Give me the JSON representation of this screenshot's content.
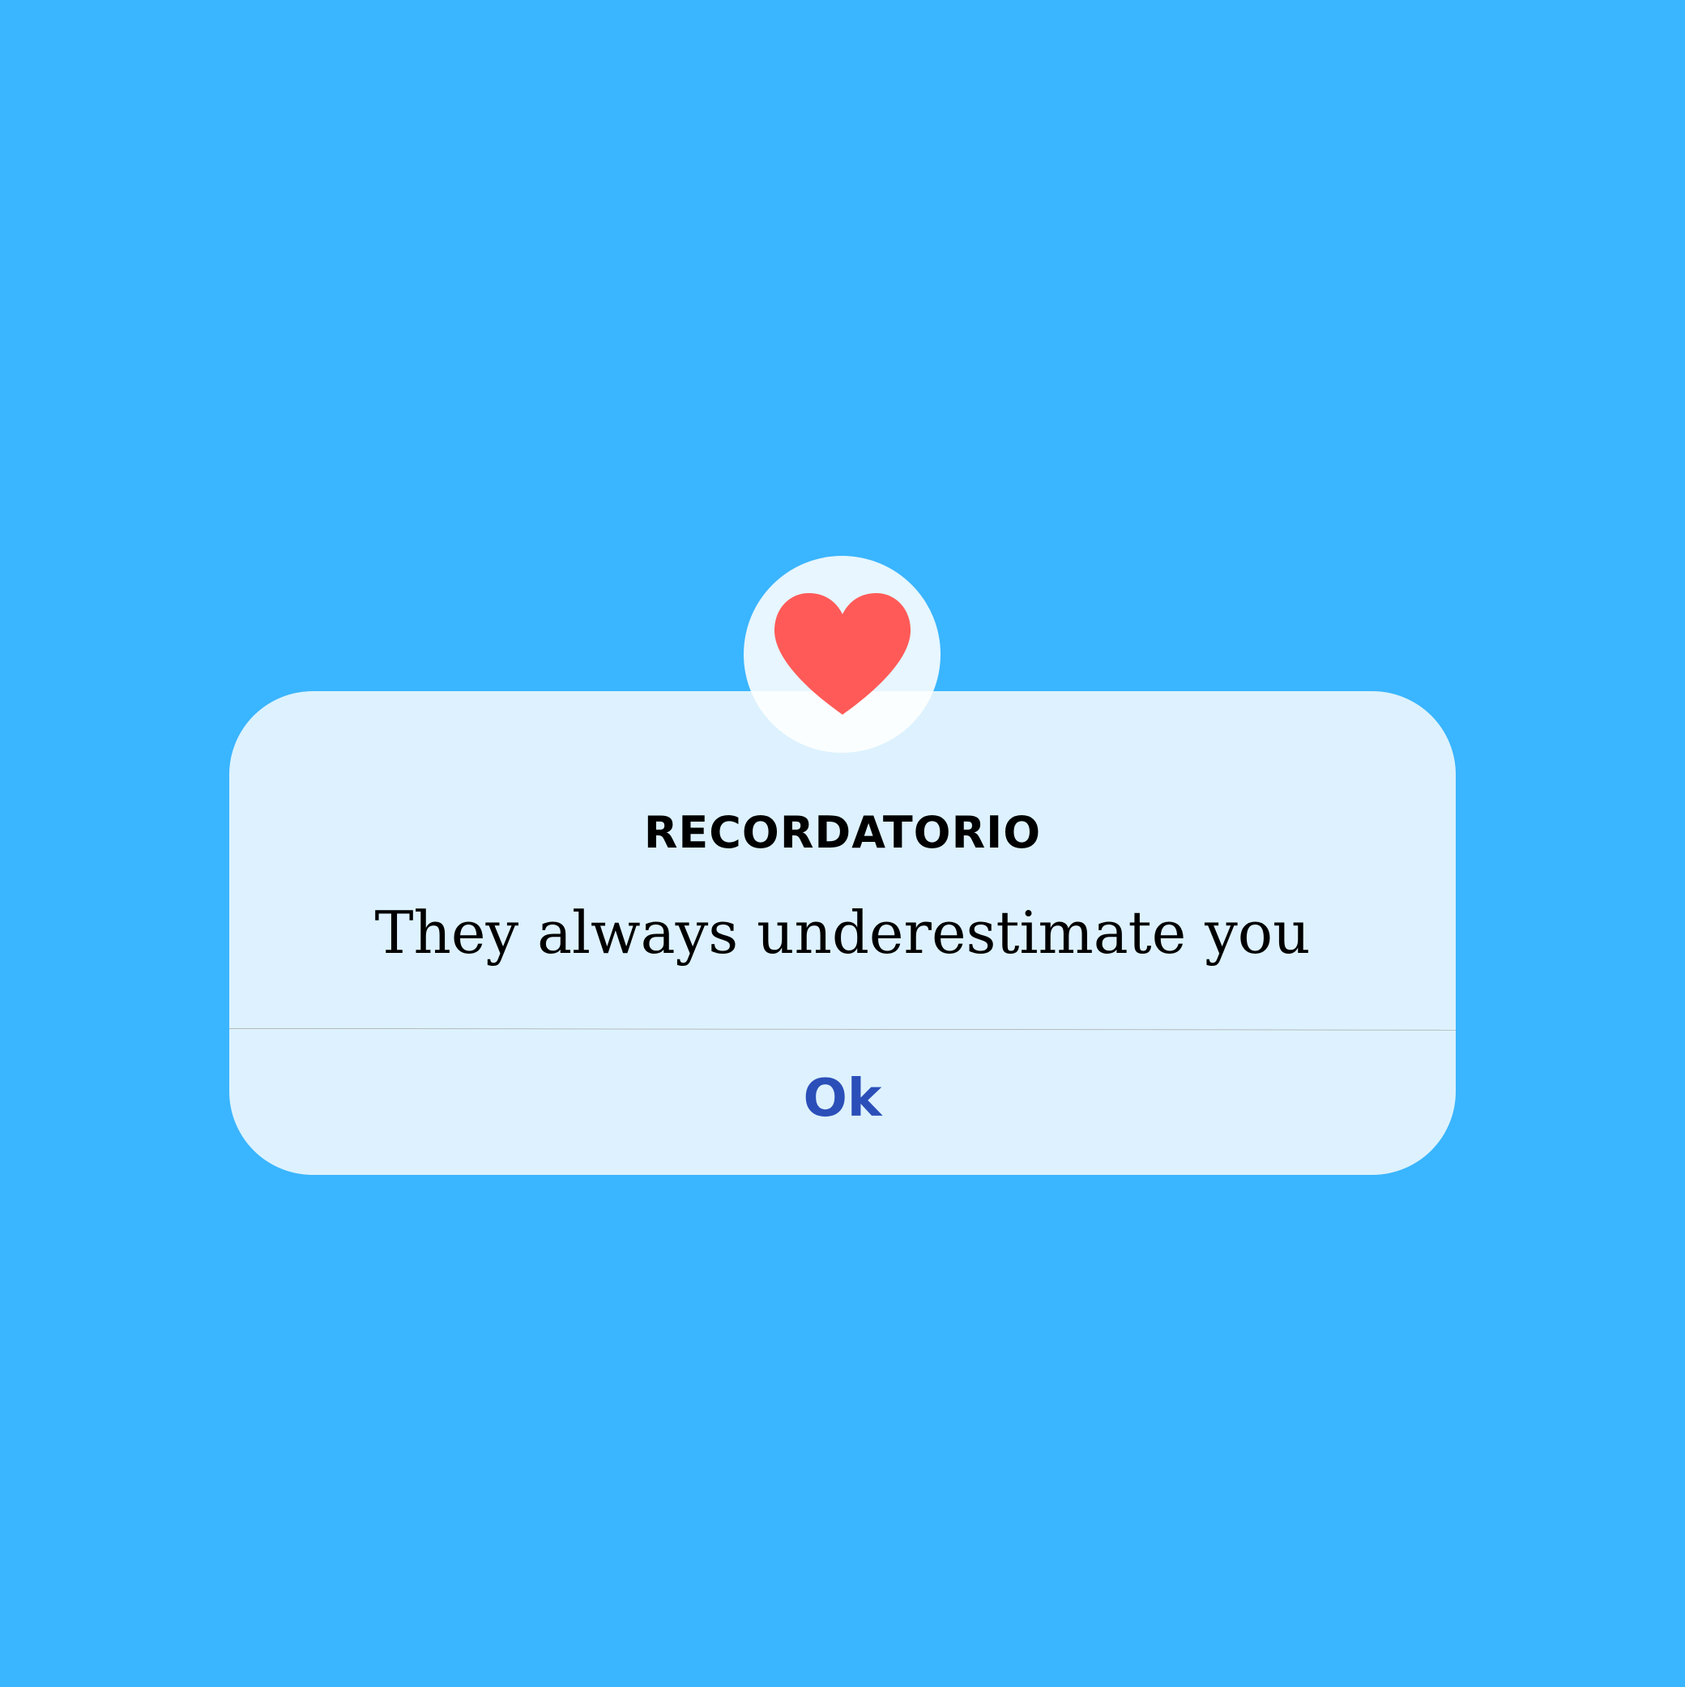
{
  "dialog": {
    "icon": "heart-icon",
    "title": "RECORDATORIO",
    "message": "They always underestimate you",
    "ok_label": "Ok"
  },
  "colors": {
    "background": "#3ab5ff",
    "dialog": "#ddf2fe",
    "heart": "#ff5a58",
    "button_text": "#2b4fb8",
    "divider": "#a8a8a8"
  }
}
